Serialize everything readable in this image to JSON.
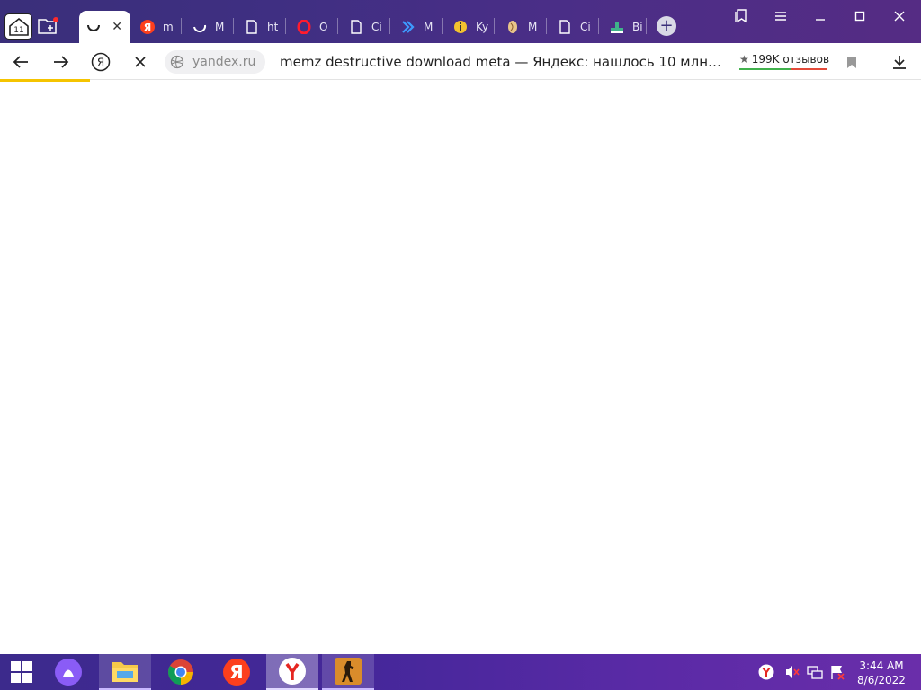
{
  "browser": {
    "home_badge": "11",
    "tabs": [
      {
        "label": "",
        "favicon": "loading-spinner",
        "active": true
      },
      {
        "label": "m",
        "favicon": "yandex-logo"
      },
      {
        "label": "M",
        "favicon": "loading-spinner"
      },
      {
        "label": "ht",
        "favicon": "page-icon"
      },
      {
        "label": "O",
        "favicon": "opera-icon"
      },
      {
        "label": "Ci",
        "favicon": "page-icon"
      },
      {
        "label": "M",
        "favicon": "chevrons-icon"
      },
      {
        "label": "Ky",
        "favicon": "info-icon"
      },
      {
        "label": "M",
        "favicon": "seed-icon"
      },
      {
        "label": "Ci",
        "favicon": "page-icon"
      },
      {
        "label": "Bi",
        "favicon": "chart-icon"
      }
    ],
    "new_tab_symbol": "+",
    "address": {
      "domain": "yandex.ru",
      "title": "memz destructive download meta — Яндекс: нашлось 10 млн…",
      "rating": "199K отзывов"
    }
  },
  "taskbar": {
    "apps": [
      {
        "name": "alice-assistant"
      },
      {
        "name": "file-explorer"
      },
      {
        "name": "chrome"
      },
      {
        "name": "yandex"
      },
      {
        "name": "yandex-browser"
      },
      {
        "name": "counter-strike"
      }
    ],
    "clock": {
      "time": "3:44 AM",
      "date": "8/6/2022"
    }
  },
  "colors": {
    "tabstrip": "#3f2f82",
    "taskbar": "#45279a",
    "progress": "#f5c400",
    "yandex_red": "#fc3f1d"
  }
}
